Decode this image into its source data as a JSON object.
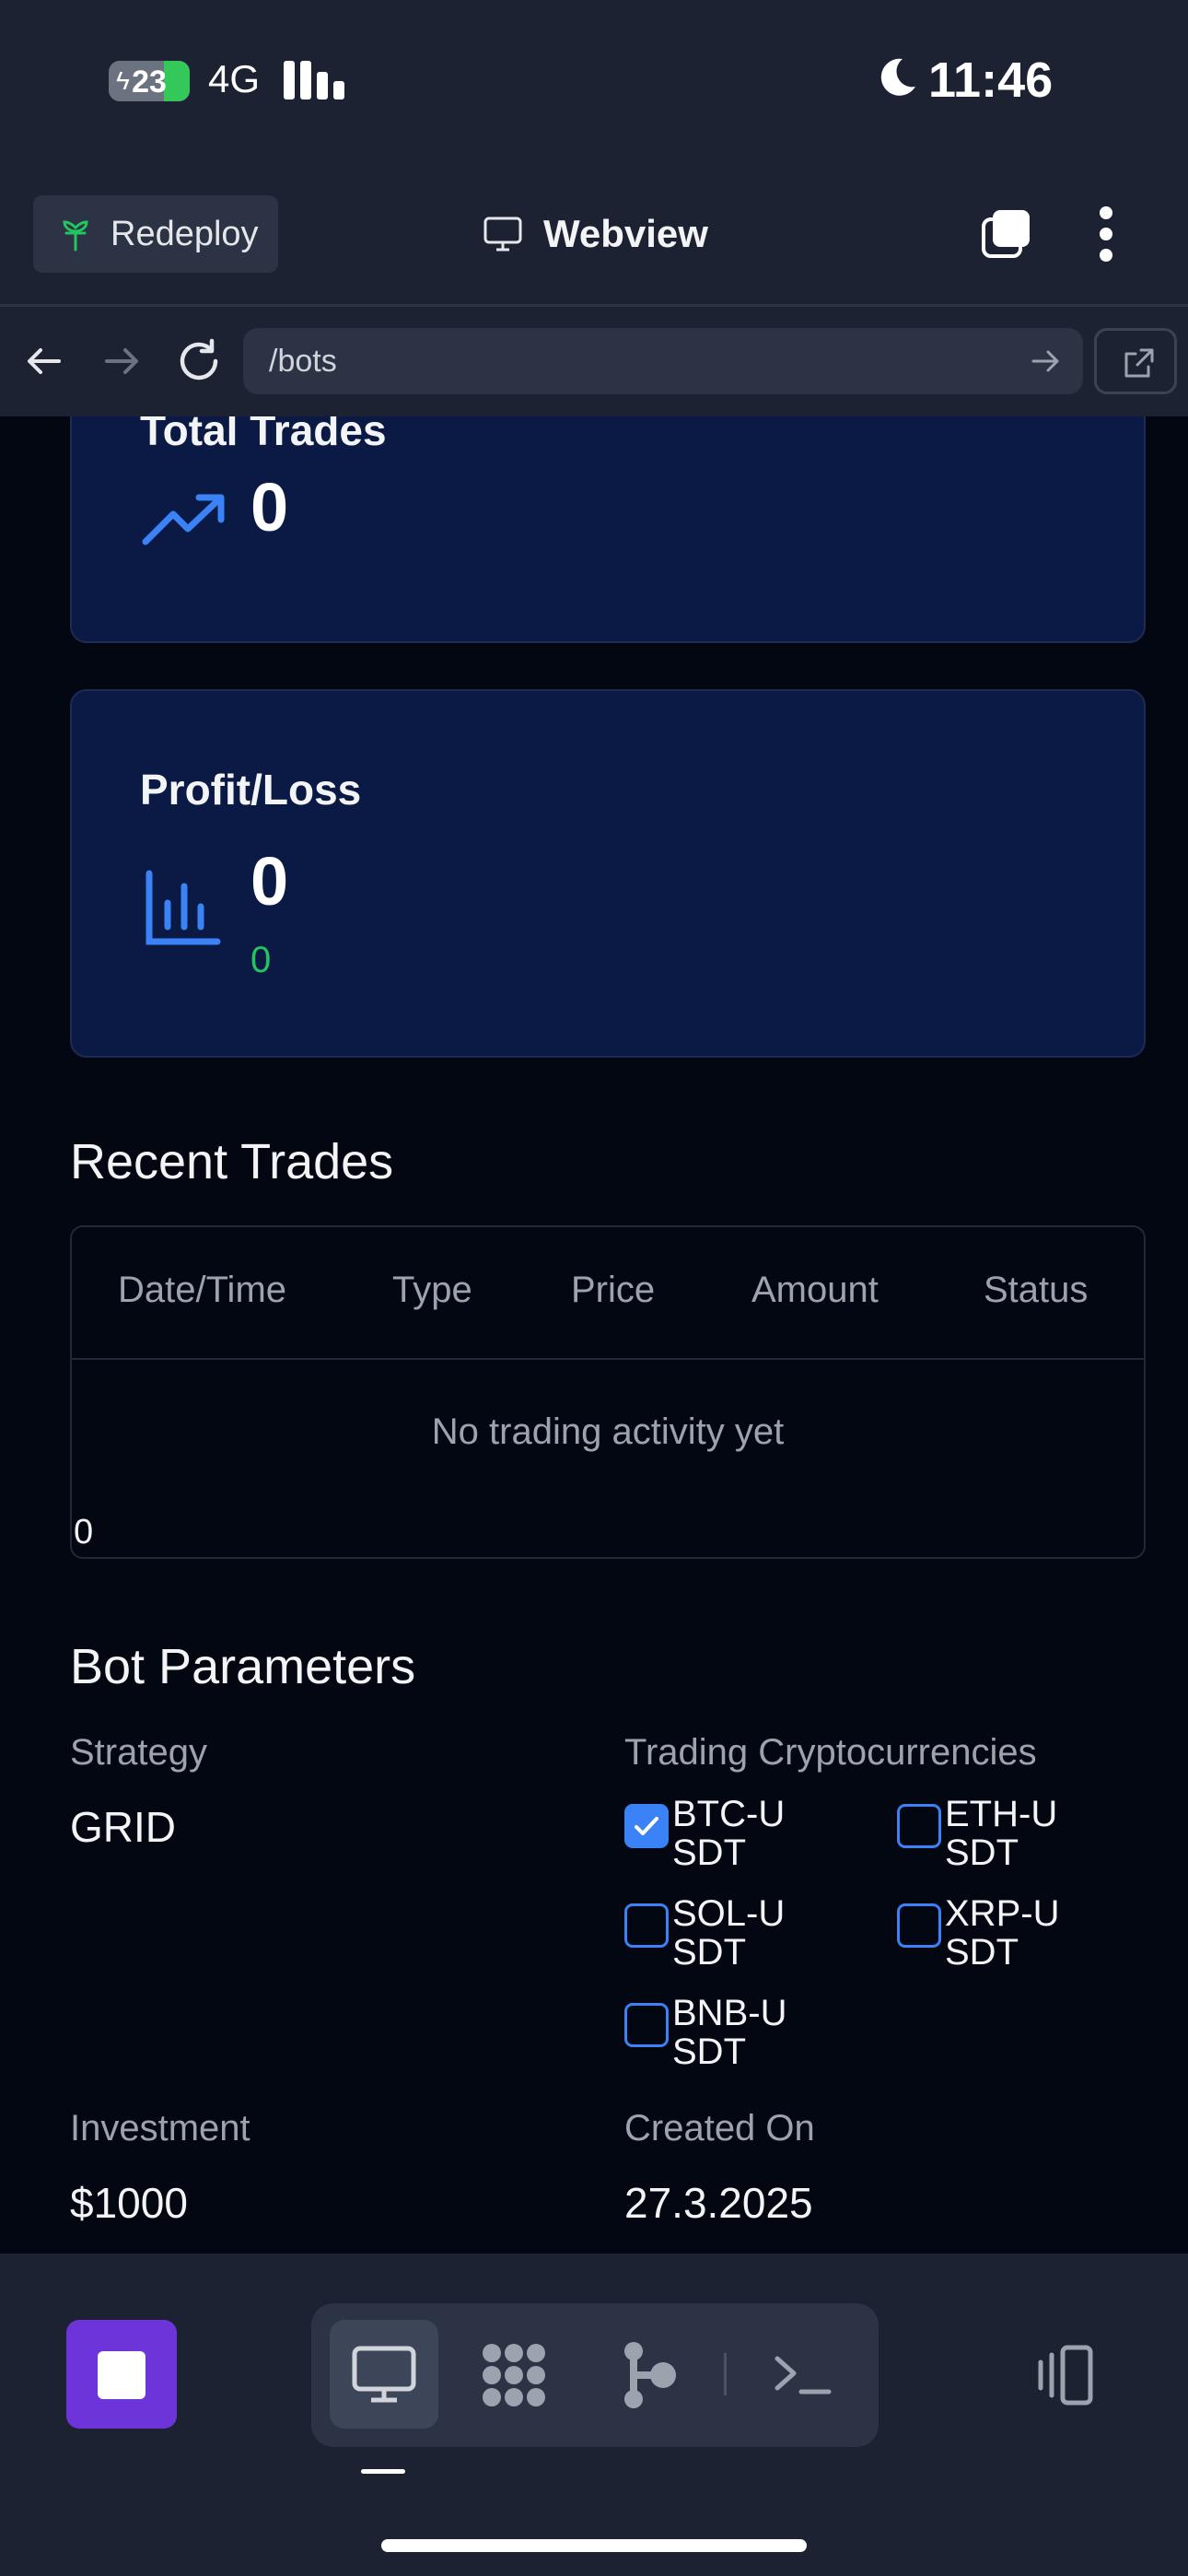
{
  "status_bar": {
    "battery": "23",
    "network": "4G",
    "time": "11:46"
  },
  "header": {
    "redeploy_label": "Redeploy",
    "title": "Webview"
  },
  "address_bar": {
    "url": "/bots"
  },
  "stats": {
    "total_trades_label": "Total Trades",
    "total_trades_value": "0",
    "profit_loss_label": "Profit/Loss",
    "profit_loss_value": "0",
    "profit_loss_change": "0"
  },
  "recent_trades": {
    "title": "Recent Trades",
    "columns": [
      "Date/Time",
      "Type",
      "Price",
      "Amount",
      "Status"
    ],
    "empty_message": "No trading activity yet",
    "count": "0"
  },
  "bot_parameters": {
    "title": "Bot Parameters",
    "strategy_label": "Strategy",
    "strategy_value": "GRID",
    "cryptos_label": "Trading Cryptocurrencies",
    "cryptos": [
      {
        "label": "BTC-USDT",
        "checked": true
      },
      {
        "label": "ETH-USDT",
        "checked": false
      },
      {
        "label": "SOL-USDT",
        "checked": false
      },
      {
        "label": "XRP-USDT",
        "checked": false
      },
      {
        "label": "BNB-USDT",
        "checked": false
      }
    ],
    "investment_label": "Investment",
    "investment_value": "$1000",
    "created_label": "Created On",
    "created_value": "27.3.2025"
  },
  "toolbar": {
    "terminal_glyph": ">_"
  },
  "colors": {
    "accent": "#3b82f6",
    "profit": "#22c55e",
    "stop_button": "#6d35d9",
    "card_bg": "#0b1a44"
  }
}
